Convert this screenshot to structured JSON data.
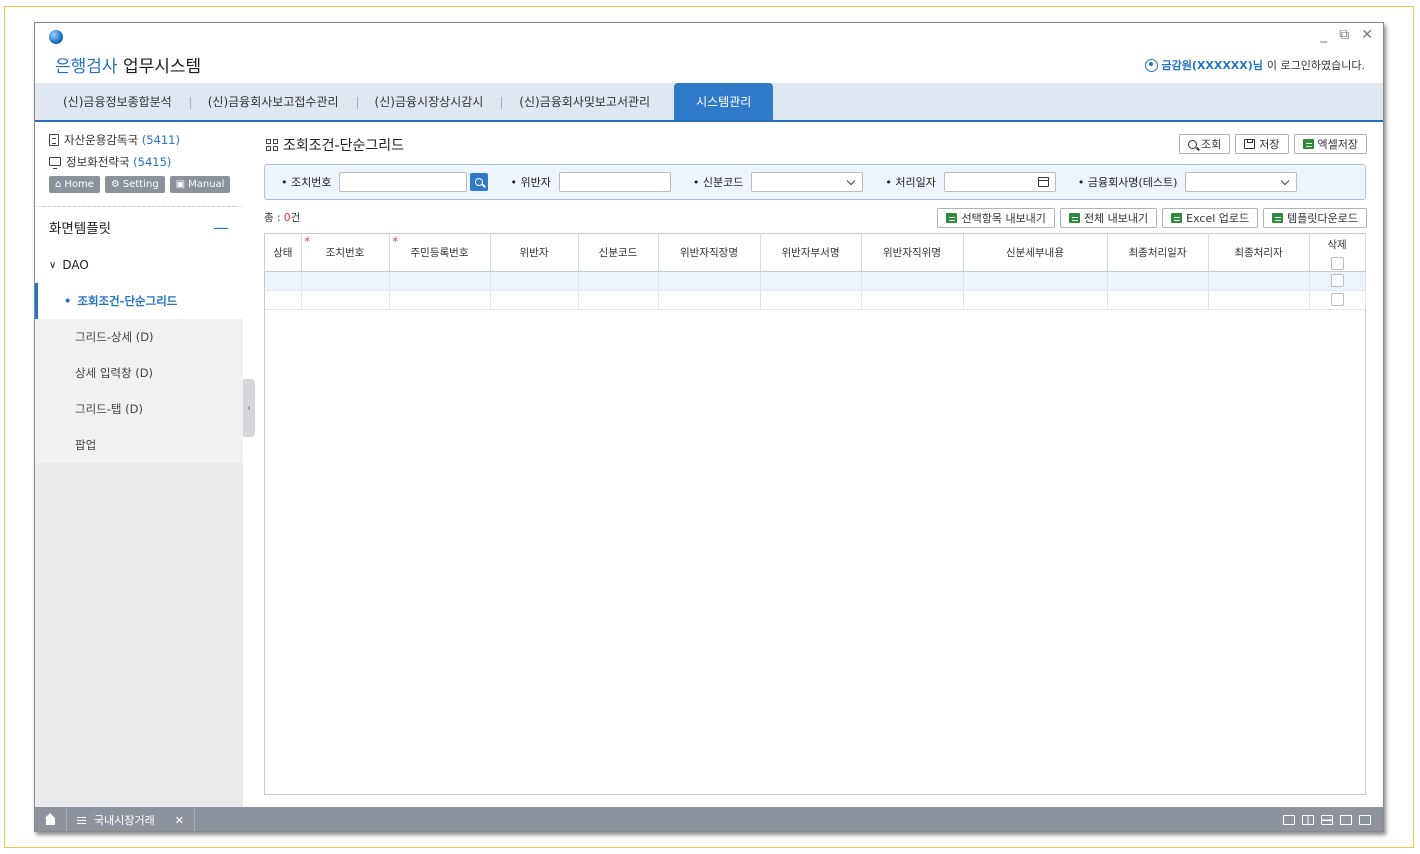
{
  "app": {
    "title_highlight": "은행검사",
    "title_rest": " 업무시스템",
    "window_controls": [
      "_",
      "⧉",
      "✕"
    ],
    "login": {
      "user": "금감원(XXXXXX)님",
      "suffix": "이 로그인하였습니다."
    }
  },
  "topnav": {
    "tabs": [
      {
        "label": "(신)금융정보종합분석",
        "active": false
      },
      {
        "label": "(신)금융회사보고접수관리",
        "active": false
      },
      {
        "label": "(신)금융시장상시감시",
        "active": false
      },
      {
        "label": "(신)금융회사및보고서관리",
        "active": false
      },
      {
        "label": "시스템관리",
        "active": true
      }
    ]
  },
  "sidebar": {
    "orgs": [
      {
        "name": "자산운용감독국 ",
        "code": "(5411)",
        "icon": "document-icon"
      },
      {
        "name": "정보화전략국 ",
        "code": "(5415)",
        "icon": "monitor-icon"
      }
    ],
    "buttons": {
      "home": "Home",
      "setting": "Setting",
      "manual": "Manual"
    },
    "section_title": "화면템플릿",
    "group": "DAO",
    "items": [
      "조회조건-단순그리드",
      "그리드-상세 (D)",
      "상세 입력창 (D)",
      "그리드-탭 (D)",
      "팝업"
    ],
    "active_item": "조회조건-단순그리드"
  },
  "page": {
    "title": "조회조건-단순그리드",
    "actions": {
      "search": "조회",
      "save": "저장",
      "excel_save": "엑셀저장"
    }
  },
  "search": {
    "fields": {
      "action_no": "조치번호",
      "violator": "위반자",
      "status_code": "신분코드",
      "process_date": "처리일자",
      "company_name": "금융회사명(테스트)"
    }
  },
  "grid": {
    "count_prefix": "총 : ",
    "count_value": "0",
    "count_suffix": "건",
    "actions": {
      "export_selected": "선택항목 내보내기",
      "export_all": "전체 내보내기",
      "excel_upload": "Excel 업로드",
      "template_download": "템플릿다운로드"
    },
    "columns": [
      "상태",
      "조치번호",
      "주민등록번호",
      "위반자",
      "신분코드",
      "위반자직장명",
      "위반자부서명",
      "위반자직위명",
      "신분세부내용",
      "최종처리일자",
      "최종처리자",
      "삭제"
    ],
    "required_columns": [
      "조치번호",
      "주민등록번호"
    ],
    "rows": [
      [
        "",
        "",
        "",
        "",
        "",
        "",
        "",
        "",
        "",
        "",
        ""
      ],
      [
        "",
        "",
        "",
        "",
        "",
        "",
        "",
        "",
        "",
        "",
        ""
      ]
    ]
  },
  "bottom_bar": {
    "open_tab": "국내시장거래",
    "close": "✕"
  }
}
